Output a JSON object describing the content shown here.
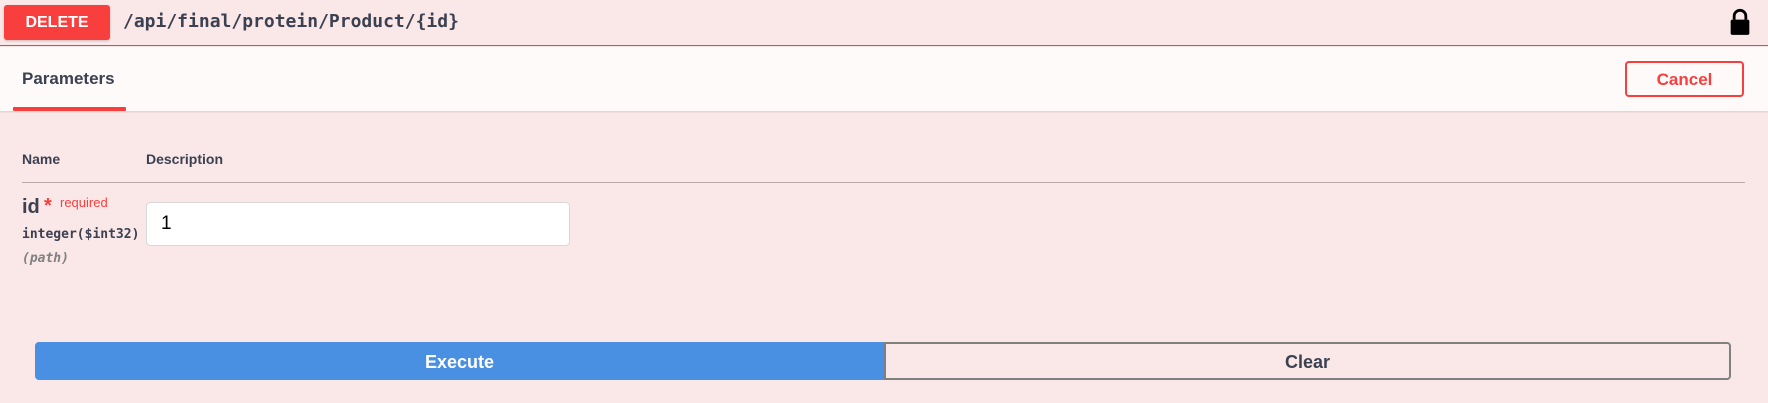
{
  "summary": {
    "method": "DELETE",
    "path": "/api/final/protein/Product/{id}",
    "lock_icon": "lock-icon"
  },
  "section": {
    "tab_label": "Parameters",
    "cancel_label": "Cancel"
  },
  "params_table": {
    "headers": [
      "Name",
      "Description"
    ],
    "rows": [
      {
        "name": "id",
        "star": "*",
        "required_label": "required",
        "type": "integer($int32)",
        "in": "(path)",
        "value": "1"
      }
    ]
  },
  "actions": {
    "execute_label": "Execute",
    "clear_label": "Clear"
  },
  "colors": {
    "method_delete": "#f93e3e",
    "execute_blue": "#4990e2",
    "background": "#fae7e7",
    "text": "#3b4151"
  }
}
